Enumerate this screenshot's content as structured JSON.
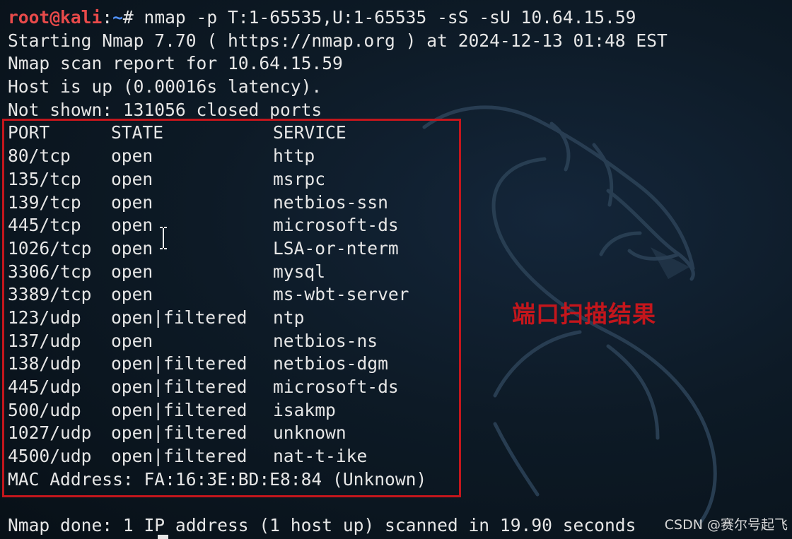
{
  "terminal": {
    "prompt": {
      "user_host": "root@kali",
      "separator": ":",
      "path": "~",
      "symbol": "# ",
      "command": "nmap -p T:1-65535,U:1-65535 -sS -sU 10.64.15.59"
    },
    "header_lines": [
      "Starting Nmap 7.70 ( https://nmap.org ) at 2024-12-13 01:48 EST",
      "Nmap scan report for 10.64.15.59",
      "Host is up (0.00016s latency).",
      "Not shown: 131056 closed ports"
    ],
    "table": {
      "columns": [
        "PORT",
        "STATE",
        "SERVICE"
      ],
      "rows": [
        [
          "80/tcp",
          "open",
          "http"
        ],
        [
          "135/tcp",
          "open",
          "msrpc"
        ],
        [
          "139/tcp",
          "open",
          "netbios-ssn"
        ],
        [
          "445/tcp",
          "open",
          "microsoft-ds"
        ],
        [
          "1026/tcp",
          "open",
          "LSA-or-nterm"
        ],
        [
          "3306/tcp",
          "open",
          "mysql"
        ],
        [
          "3389/tcp",
          "open",
          "ms-wbt-server"
        ],
        [
          "123/udp",
          "open|filtered",
          "ntp"
        ],
        [
          "137/udp",
          "open",
          "netbios-ns"
        ],
        [
          "138/udp",
          "open|filtered",
          "netbios-dgm"
        ],
        [
          "445/udp",
          "open|filtered",
          "microsoft-ds"
        ],
        [
          "500/udp",
          "open|filtered",
          "isakmp"
        ],
        [
          "1027/udp",
          "open|filtered",
          "unknown"
        ],
        [
          "4500/udp",
          "open|filtered",
          "nat-t-ike"
        ]
      ]
    },
    "mac_line": "MAC Address: FA:16:3E:BD:E8:84 (Unknown)",
    "footer_line": "Nmap done: 1 IP address (1 host up) scanned in 19.90 seconds"
  },
  "annotation": {
    "text": "端口扫描结果"
  },
  "watermark": "CSDN @赛尔号起飞",
  "colors": {
    "background": "#0b1620",
    "text": "#e6e6e6",
    "prompt_user": "#e84a4a",
    "prompt_path": "#4f8ff7",
    "highlight": "#c4161c"
  },
  "icons": {
    "background_art": "kali-dragon-icon",
    "text_cursor": "ibeam-cursor-icon"
  }
}
